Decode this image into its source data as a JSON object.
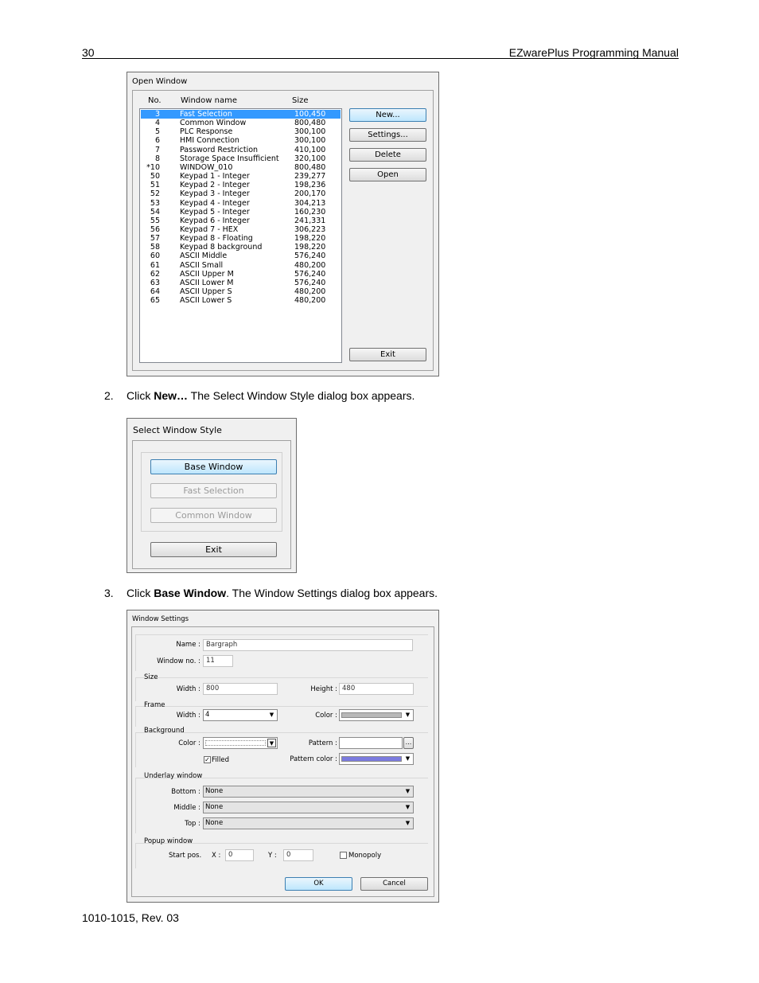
{
  "page": {
    "number": "30",
    "header_title": "EZwarePlus Programming Manual",
    "footer": "1010-1015, Rev. 03"
  },
  "steps": [
    {
      "num": "2.",
      "pre": "Click ",
      "bold": "New…",
      "post": " The Select Window Style dialog box appears."
    },
    {
      "num": "3.",
      "pre": "Click ",
      "bold": "Base Window",
      "post": ". The Window Settings dialog box appears."
    }
  ],
  "open_window": {
    "title": "Open Window",
    "columns": {
      "no": "No.",
      "name": "Window name",
      "size": "Size"
    },
    "rows": [
      {
        "no": "3",
        "name": "Fast Selection",
        "size": "100,450"
      },
      {
        "no": "4",
        "name": "Common Window",
        "size": "800,480"
      },
      {
        "no": "5",
        "name": "PLC Response",
        "size": "300,100"
      },
      {
        "no": "6",
        "name": "HMI Connection",
        "size": "300,100"
      },
      {
        "no": "7",
        "name": "Password Restriction",
        "size": "410,100"
      },
      {
        "no": "8",
        "name": "Storage Space Insufficient",
        "size": "320,100"
      },
      {
        "no": "*10",
        "name": "WINDOW_010",
        "size": "800,480"
      },
      {
        "no": "50",
        "name": "Keypad 1 - Integer",
        "size": "239,277"
      },
      {
        "no": "51",
        "name": "Keypad 2 - Integer",
        "size": "198,236"
      },
      {
        "no": "52",
        "name": "Keypad 3 - Integer",
        "size": "200,170"
      },
      {
        "no": "53",
        "name": "Keypad 4 - Integer",
        "size": "304,213"
      },
      {
        "no": "54",
        "name": "Keypad 5 - Integer",
        "size": "160,230"
      },
      {
        "no": "55",
        "name": "Keypad 6 - Integer",
        "size": "241,331"
      },
      {
        "no": "56",
        "name": "Keypad 7 - HEX",
        "size": "306,223"
      },
      {
        "no": "57",
        "name": "Keypad 8 - Floating",
        "size": "198,220"
      },
      {
        "no": "58",
        "name": "Keypad 8 background",
        "size": "198,220"
      },
      {
        "no": "60",
        "name": "ASCII Middle",
        "size": "576,240"
      },
      {
        "no": "61",
        "name": "ASCII Small",
        "size": "480,200"
      },
      {
        "no": "62",
        "name": "ASCII Upper M",
        "size": "576,240"
      },
      {
        "no": "63",
        "name": "ASCII Lower M",
        "size": "576,240"
      },
      {
        "no": "64",
        "name": "ASCII Upper S",
        "size": "480,200"
      },
      {
        "no": "65",
        "name": "ASCII Lower S",
        "size": "480,200"
      }
    ],
    "buttons": {
      "new": "New...",
      "settings": "Settings...",
      "delete": "Delete",
      "open": "Open",
      "exit": "Exit"
    }
  },
  "select_style": {
    "title": "Select Window Style",
    "buttons": {
      "base": "Base Window",
      "fast": "Fast Selection",
      "common": "Common Window",
      "exit": "Exit"
    }
  },
  "settings": {
    "title": "Window Settings",
    "name_label": "Name :",
    "name_value": "Bargraph",
    "winno_label": "Window no. :",
    "winno_value": "11",
    "size_group": "Size",
    "width_label": "Width :",
    "width_value": "800",
    "height_label": "Height :",
    "height_value": "480",
    "frame_group": "Frame",
    "frame_width_label": "Width :",
    "frame_width_value": "4",
    "frame_color_label": "Color :",
    "bg_group": "Background",
    "bg_color_label": "Color :",
    "pattern_label": "Pattern :",
    "pattern_btn": "...",
    "filled_label": "Filled",
    "pattern_color_label": "Pattern color :",
    "underlay_group": "Underlay window",
    "bottom_label": "Bottom :",
    "bottom_value": "None",
    "middle_label": "Middle :",
    "middle_value": "None",
    "top_label": "Top :",
    "top_value": "None",
    "popup_group": "Popup window",
    "start_label": "Start pos.",
    "x_label": "X :",
    "x_value": "0",
    "y_label": "Y :",
    "y_value": "0",
    "monopoly_label": "Monopoly",
    "ok": "OK",
    "cancel": "Cancel",
    "colors": {
      "frame": "#b8b8b8",
      "pattern": "#7b7bdf"
    }
  }
}
